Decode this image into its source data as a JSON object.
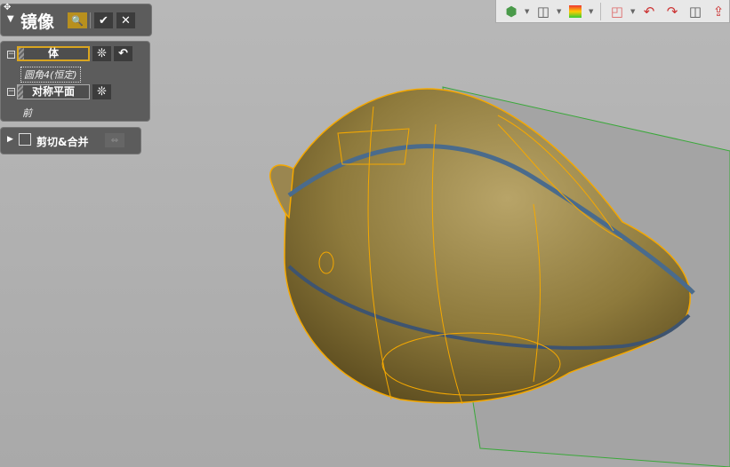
{
  "panel": {
    "title": "镜像",
    "pin_icon": "pin-icon",
    "collapse_icon": "triangle-down-icon"
  },
  "actions": {
    "preview": "preview-icon",
    "ok": "✔",
    "cancel": "✕"
  },
  "body_field": {
    "label": "体",
    "value": "圆角4(恒定)",
    "snowflake": "❊",
    "undo": "↶"
  },
  "plane_field": {
    "label": "对称平面",
    "value": "前",
    "snowflake": "❊"
  },
  "trim": {
    "label": "剪切&合并",
    "checked": false
  },
  "toolbar": {
    "icons": [
      "view-orient-icon",
      "display-style-icon",
      "appearance-icon",
      "section-view-icon",
      "rotate-left-icon",
      "rotate-right-icon",
      "split-view-icon",
      "normal-to-icon"
    ]
  },
  "colors": {
    "accent": "#d9a520",
    "panel": "#5c5c5c",
    "model": "#a89050",
    "edge": "#f5a800",
    "plane": "#3aa83a"
  }
}
